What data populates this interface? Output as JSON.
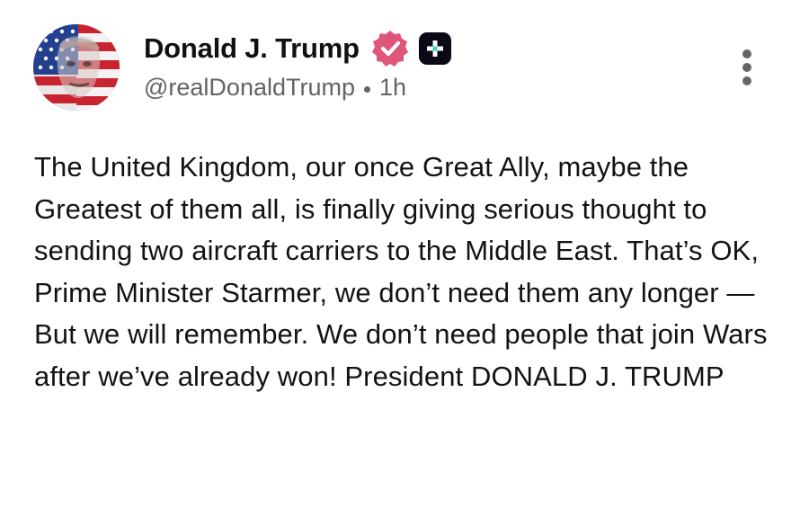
{
  "post": {
    "author": {
      "display_name": "Donald J. Trump",
      "handle": "@realDonaldTrump",
      "verified_icon": "verified-badge-icon",
      "plus_icon": "plus-badge-icon",
      "verified_color": "#e0567a"
    },
    "timestamp": "1h",
    "text": "The United Kingdom, our once Great Ally, maybe the Greatest of them all, is finally giving serious thought to sending two aircraft carriers to the Middle East. That’s OK, Prime Minister Starmer, we don’t need them any longer — But we will remember. We don’t need people that join Wars after we’ve already won! President DONALD J. TRUMP",
    "more_icon": "vertical-ellipsis-icon"
  }
}
